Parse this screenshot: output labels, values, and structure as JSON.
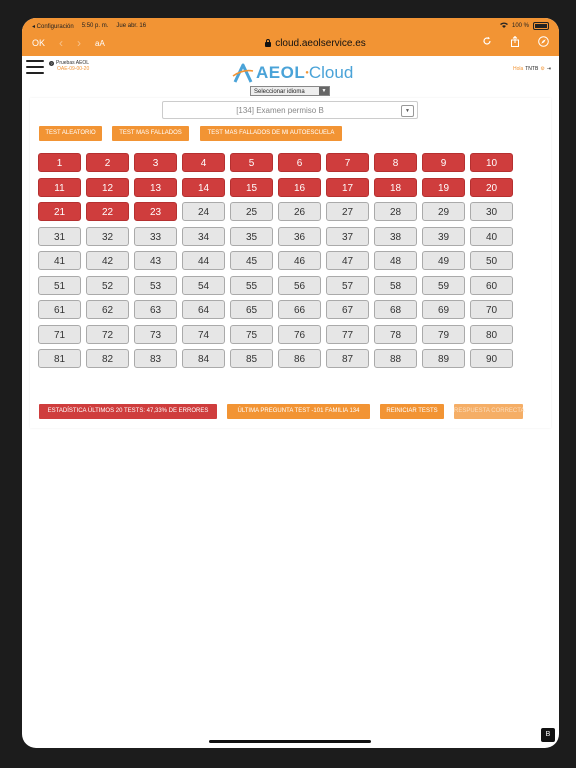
{
  "status_bar": {
    "back_app": "◂ Configuración",
    "time": "5:50 p. m.",
    "date": "Jue abr. 16",
    "wifi": "wifi-icon",
    "battery": "100 %"
  },
  "browser": {
    "done_label": "OK",
    "text_size_label": "aA",
    "url": "cloud.aeolservice.es"
  },
  "app": {
    "org_name": "Pruebas AEOL",
    "org_code": "OAE-09-00-20",
    "logo_part1": "AEOL",
    "logo_part2": "Cloud",
    "user_prefix": "Hola",
    "user_name": "TNTB",
    "language_select": "Seleccionar idioma"
  },
  "exam": {
    "selected": "[134] Examen permiso B"
  },
  "actions_top": [
    "TEST ALEATORIO",
    "TEST MAS FALLADOS",
    "TEST MAS FALLADOS DE MI AUTOESCUELA"
  ],
  "tests": {
    "total": 90,
    "completed_through": 23,
    "columns": 10
  },
  "actions_bottom": {
    "stats": "ESTADÍSTICA ÚLTIMOS 20 TESTS: 47,33% DE ERRORES",
    "last_question": "ÚLTIMA PREGUNTA TEST -101 FAMILIA 134",
    "reset": "REINICIAR TESTS",
    "faded": "RESPUESTA CORRECTA"
  },
  "colors": {
    "accent": "#f29434",
    "completed": "#cf3d3d",
    "pending": "#e6e6e6",
    "logo": "#4aa3d8"
  }
}
